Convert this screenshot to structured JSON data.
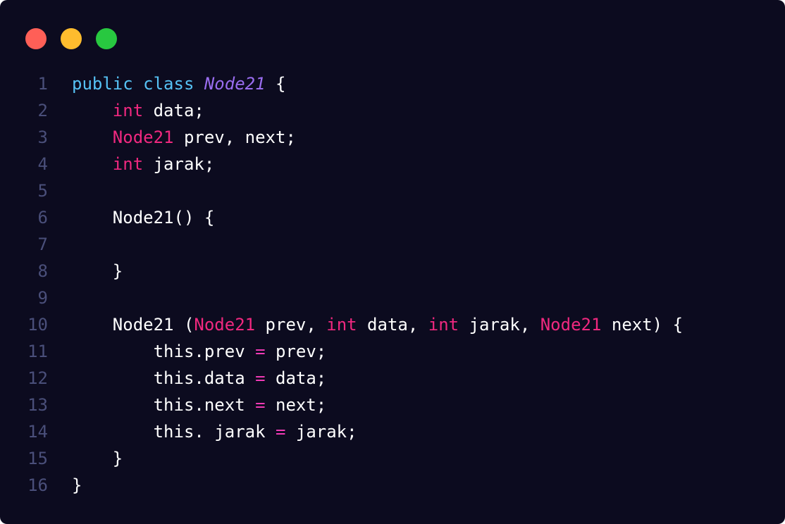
{
  "window": {
    "background": "#0c0b1f",
    "controls": {
      "close_color": "#ff5f57",
      "minimize_color": "#febc2e",
      "maximize_color": "#28c840"
    }
  },
  "code": {
    "language": "java",
    "lines": [
      {
        "number": "1",
        "indent": "",
        "tokens": [
          {
            "t": "public",
            "k": "kw"
          },
          {
            "t": " ",
            "k": "plain"
          },
          {
            "t": "class",
            "k": "kw"
          },
          {
            "t": " ",
            "k": "plain"
          },
          {
            "t": "Node21",
            "k": "class"
          },
          {
            "t": " {",
            "k": "plain"
          }
        ]
      },
      {
        "number": "2",
        "indent": "    ",
        "tokens": [
          {
            "t": "int",
            "k": "type"
          },
          {
            "t": " data;",
            "k": "plain"
          }
        ]
      },
      {
        "number": "3",
        "indent": "    ",
        "tokens": [
          {
            "t": "Node21",
            "k": "type"
          },
          {
            "t": " prev, next;",
            "k": "plain"
          }
        ]
      },
      {
        "number": "4",
        "indent": "    ",
        "tokens": [
          {
            "t": "int",
            "k": "type"
          },
          {
            "t": " jarak;",
            "k": "plain"
          }
        ]
      },
      {
        "number": "5",
        "indent": "",
        "tokens": []
      },
      {
        "number": "6",
        "indent": "    ",
        "tokens": [
          {
            "t": "Node21() {",
            "k": "plain"
          }
        ]
      },
      {
        "number": "7",
        "indent": "",
        "tokens": []
      },
      {
        "number": "8",
        "indent": "    ",
        "tokens": [
          {
            "t": "}",
            "k": "plain"
          }
        ]
      },
      {
        "number": "9",
        "indent": "",
        "tokens": []
      },
      {
        "number": "10",
        "indent": "    ",
        "tokens": [
          {
            "t": "Node21 (",
            "k": "plain"
          },
          {
            "t": "Node21",
            "k": "type"
          },
          {
            "t": " prev, ",
            "k": "plain"
          },
          {
            "t": "int",
            "k": "type"
          },
          {
            "t": " data, ",
            "k": "plain"
          },
          {
            "t": "int",
            "k": "type"
          },
          {
            "t": " jarak, ",
            "k": "plain"
          },
          {
            "t": "Node21",
            "k": "type"
          },
          {
            "t": " next) {",
            "k": "plain"
          }
        ]
      },
      {
        "number": "11",
        "indent": "        ",
        "tokens": [
          {
            "t": "this.prev ",
            "k": "plain"
          },
          {
            "t": "=",
            "k": "op"
          },
          {
            "t": " prev;",
            "k": "plain"
          }
        ]
      },
      {
        "number": "12",
        "indent": "        ",
        "tokens": [
          {
            "t": "this.data ",
            "k": "plain"
          },
          {
            "t": "=",
            "k": "op"
          },
          {
            "t": " data;",
            "k": "plain"
          }
        ]
      },
      {
        "number": "13",
        "indent": "        ",
        "tokens": [
          {
            "t": "this.next ",
            "k": "plain"
          },
          {
            "t": "=",
            "k": "op"
          },
          {
            "t": " next;",
            "k": "plain"
          }
        ]
      },
      {
        "number": "14",
        "indent": "        ",
        "tokens": [
          {
            "t": "this. jarak ",
            "k": "plain"
          },
          {
            "t": "=",
            "k": "op"
          },
          {
            "t": " jarak;",
            "k": "plain"
          }
        ]
      },
      {
        "number": "15",
        "indent": "    ",
        "tokens": [
          {
            "t": "}",
            "k": "plain"
          }
        ]
      },
      {
        "number": "16",
        "indent": "",
        "tokens": [
          {
            "t": "}",
            "k": "plain"
          }
        ]
      }
    ]
  }
}
